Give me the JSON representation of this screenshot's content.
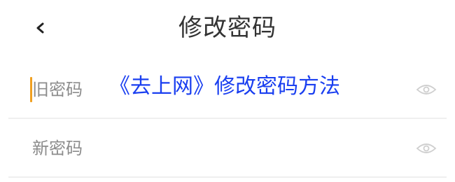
{
  "navbar": {
    "back_icon": "chevron-left-icon",
    "title": "修改密码"
  },
  "form": {
    "old_password": {
      "placeholder": "旧密码",
      "value": "",
      "eye_icon": "eye-icon",
      "focused": true
    },
    "new_password": {
      "placeholder": "新密码",
      "value": "",
      "eye_icon": "eye-icon"
    }
  },
  "overlay_caption": "《去上网》修改密码方法",
  "colors": {
    "cursor": "#f0a020",
    "overlay_text": "#1a3ff0",
    "label": "#8c8c8c",
    "divider": "#efefef"
  }
}
